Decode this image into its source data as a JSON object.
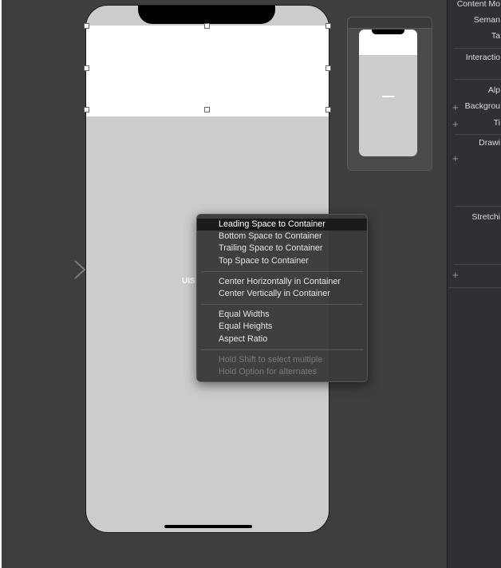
{
  "canvas": {
    "scene_label": "UIS",
    "colors": {
      "canvas_bg": "#3e3e3e",
      "phone_bg": "#cccccc",
      "header_bg": "#ffffff"
    }
  },
  "context_menu": {
    "groups": [
      [
        {
          "label": "Leading Space to Container",
          "state": "highlighted"
        },
        {
          "label": "Bottom Space to Container",
          "state": "normal"
        },
        {
          "label": "Trailing Space to Container",
          "state": "normal"
        },
        {
          "label": "Top Space to Container",
          "state": "normal"
        }
      ],
      [
        {
          "label": "Center Horizontally in Container",
          "state": "normal"
        },
        {
          "label": "Center Vertically in Container",
          "state": "normal"
        }
      ],
      [
        {
          "label": "Equal Widths",
          "state": "normal"
        },
        {
          "label": "Equal Heights",
          "state": "normal"
        },
        {
          "label": "Aspect Ratio",
          "state": "normal"
        }
      ],
      [
        {
          "label": "Hold Shift to select multiple",
          "state": "disabled"
        },
        {
          "label": "Hold Option for alternates",
          "state": "disabled"
        }
      ]
    ]
  },
  "inspector": {
    "labels": {
      "content_mode": "Content Mo",
      "semantic": "Seman",
      "tag": "Ta",
      "interaction": "Interactio",
      "alpha": "Alp",
      "background": "Backgrou",
      "tint": "Ti",
      "drawing": "Drawi",
      "stretching": "Stretchi"
    }
  }
}
